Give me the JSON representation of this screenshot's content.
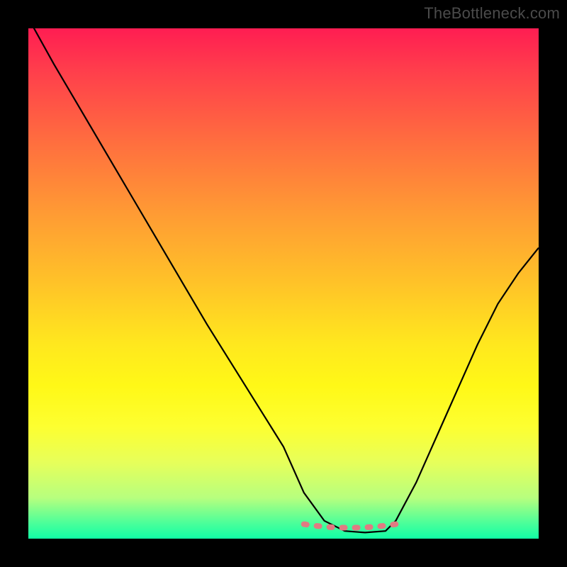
{
  "watermark": "TheBottleneck.com",
  "chart_data": {
    "type": "line",
    "title": "",
    "xlabel": "",
    "ylabel": "",
    "xlim": [
      0,
      100
    ],
    "ylim": [
      0,
      100
    ],
    "grid": false,
    "legend": false,
    "dashed_segment": {
      "color": "#e07b82",
      "x_range": [
        54,
        72
      ],
      "y": 2
    },
    "series": [
      {
        "name": "curve",
        "color": "#000000",
        "x": [
          0,
          5,
          10,
          15,
          20,
          25,
          30,
          35,
          40,
          45,
          50,
          54,
          58,
          62,
          66,
          70,
          72,
          76,
          80,
          84,
          88,
          92,
          96,
          100
        ],
        "y": [
          102,
          93,
          84.5,
          76,
          67.5,
          59,
          50.5,
          42,
          34,
          26,
          18,
          9,
          3.5,
          1.5,
          1.2,
          1.5,
          3.5,
          11,
          20,
          29,
          38,
          46,
          52,
          57
        ]
      }
    ]
  }
}
